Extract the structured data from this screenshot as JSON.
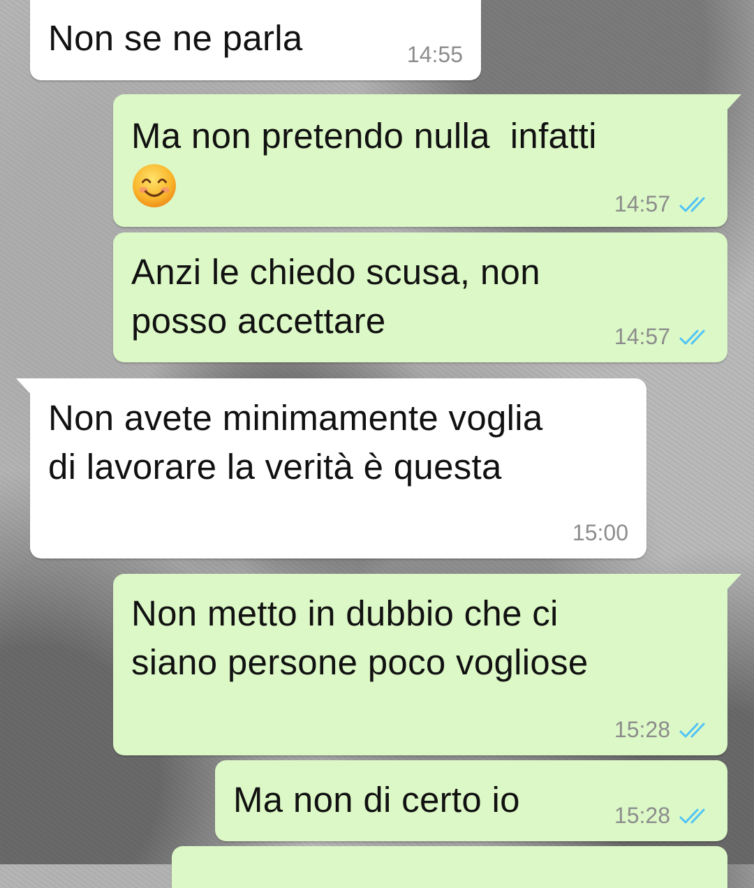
{
  "chat": {
    "messages": [
      {
        "direction": "incoming",
        "text": "Non se ne parla",
        "time": "14:55"
      },
      {
        "direction": "outgoing",
        "text": "Ma non pretendo nulla  infatti",
        "emoji": "smiling-face-emoji",
        "time": "14:57",
        "status": "read"
      },
      {
        "direction": "outgoing",
        "text": "Anzi le chiedo scusa, non\nposso accettare",
        "time": "14:57",
        "status": "read"
      },
      {
        "direction": "incoming",
        "text": "Non avete minimamente voglia\ndi lavorare la verità è questa",
        "time": "15:00"
      },
      {
        "direction": "outgoing",
        "text": "Non metto in dubbio che ci\nsiano persone poco vogliose",
        "time": "15:28",
        "status": "read"
      },
      {
        "direction": "outgoing",
        "text": "Ma non di certo io",
        "time": "15:28",
        "status": "read"
      }
    ]
  },
  "colors": {
    "incoming_bubble": "#ffffff",
    "outgoing_bubble": "#dcf8c6",
    "read_ticks": "#4fc3f7",
    "timestamp": "#8c8c8c"
  },
  "icons": {
    "read_receipt": "double-check-icon",
    "emoji": "smiling-face-emoji"
  }
}
